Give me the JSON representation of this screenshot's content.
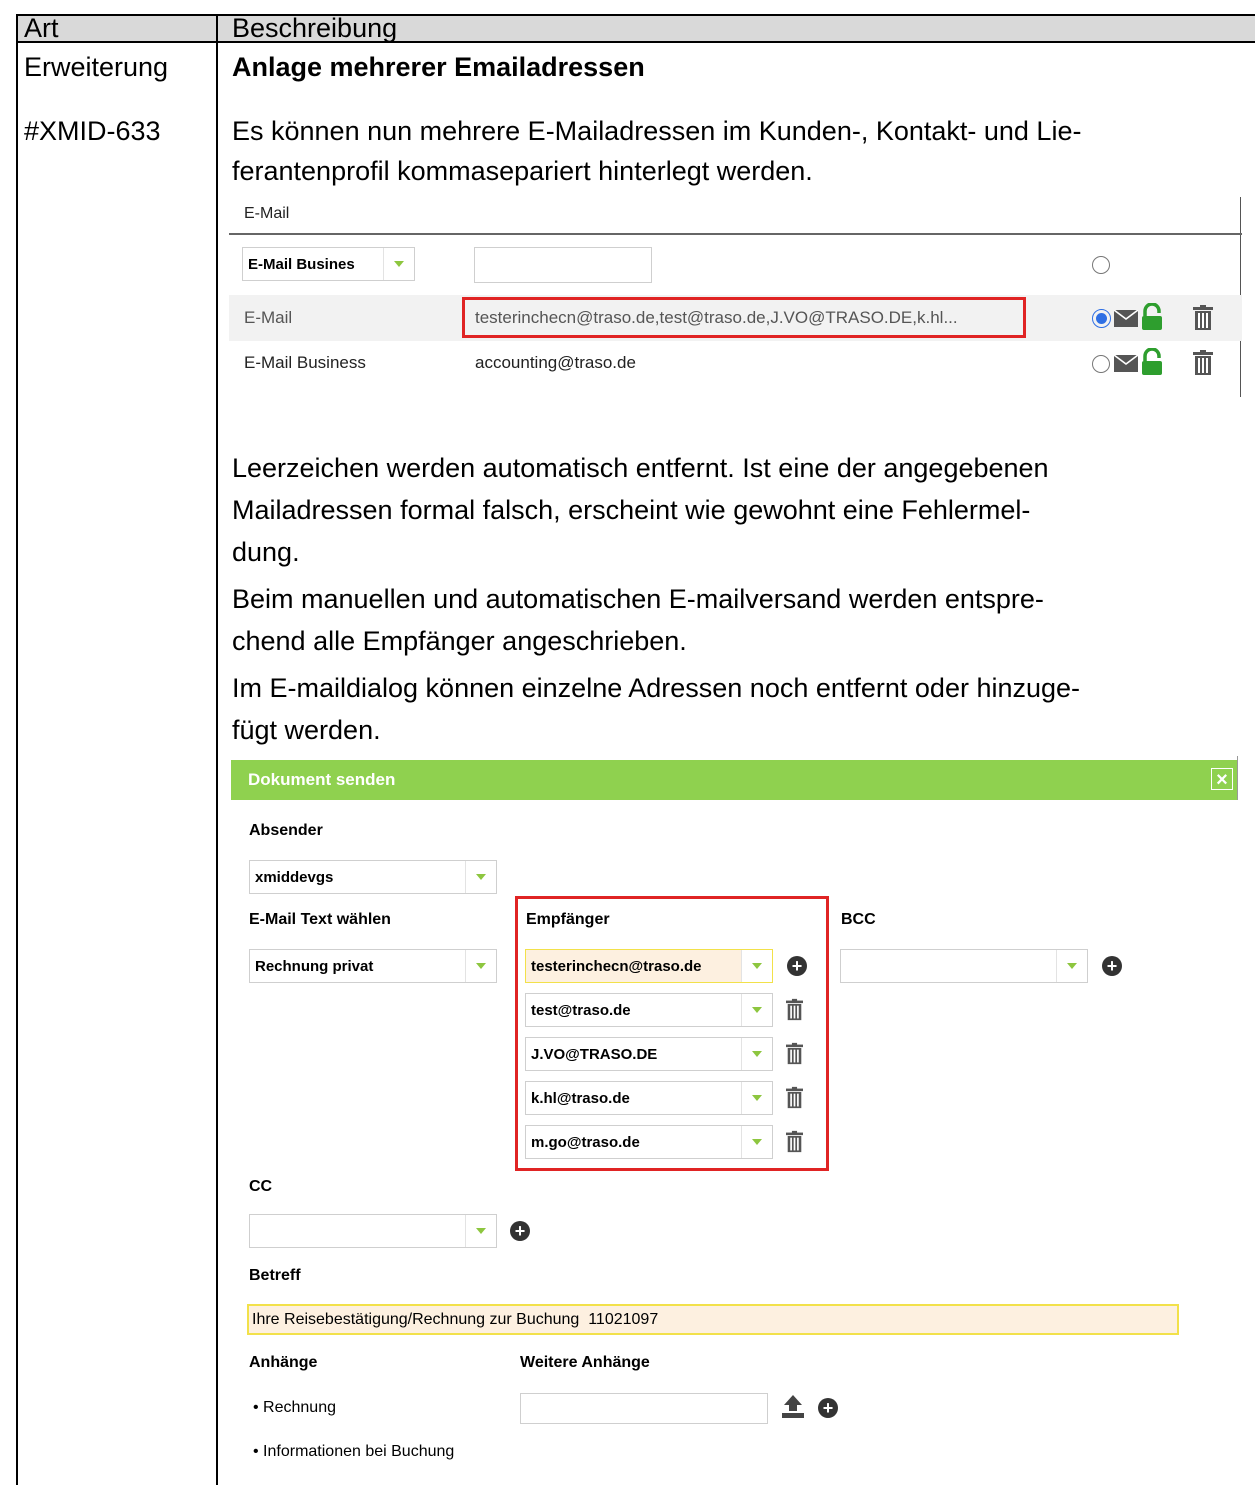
{
  "table": {
    "header_art": "Art",
    "header_beschreibung": "Beschreibung",
    "art_type": "Erweiterung",
    "art_id": "#XMID-633",
    "title": "Anlage mehrerer Emailadressen",
    "para1_line1": "Es können nun mehrere E-Mailadressen im Kunden-, Kontakt- und Lie-",
    "para1_line2": "ferantenprofil kommasepariert hinterlegt werden.",
    "para2_lines": [
      "Leerzeichen werden automatisch entfernt. Ist eine der angegebenen",
      "Mailadressen formal falsch, erscheint wie gewohnt eine Fehlermel-",
      "dung.",
      "Beim manuellen und automatischen E-mailversand werden entspre-",
      "chend alle Empfänger angeschrieben.",
      "Im E-maildialog können einzelne Adressen noch entfernt oder hinzuge-",
      "fügt werden."
    ]
  },
  "email_panel": {
    "section_title": "E-Mail",
    "type_select": "E-Mail Busines",
    "rows": [
      {
        "label": "E-Mail",
        "value": "testerinchecn@traso.de,test@traso.de,J.VO@TRASO.DE,k.hl..."
      },
      {
        "label": "E-Mail Business",
        "value": "accounting@traso.de"
      }
    ]
  },
  "dialog": {
    "title": "Dokument senden",
    "close": "×",
    "absender_label": "Absender",
    "absender_value": "xmiddevgs",
    "text_label": "E-Mail Text wählen",
    "text_value": "Rechnung privat",
    "empfaenger_label": "Empfänger",
    "empfaenger": [
      "testerinchecn@traso.de",
      "test@traso.de",
      "J.VO@TRASO.DE",
      "k.hl@traso.de",
      "m.go@traso.de"
    ],
    "bcc_label": "BCC",
    "cc_label": "CC",
    "betreff_label": "Betreff",
    "betreff_value": "Ihre Reisebestätigung/Rechnung zur Buchung  11021097",
    "anhaenge_label": "Anhänge",
    "weitere_label": "Weitere Anhänge",
    "anhaenge": [
      "Rechnung",
      "Informationen bei Buchung"
    ]
  },
  "colors": {
    "dialog_header": "#8fd14f",
    "highlight_red": "#e02424",
    "lock_green": "#2e9e2e",
    "radio_blue": "#2f6fe4",
    "betreff_bg": "#fdf0e0",
    "betreff_border": "#f2e14a"
  }
}
